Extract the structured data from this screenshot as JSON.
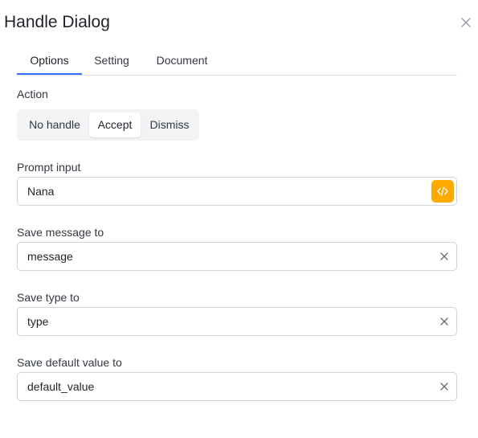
{
  "dialog": {
    "title": "Handle Dialog"
  },
  "tabs": [
    {
      "label": "Options",
      "active": true
    },
    {
      "label": "Setting",
      "active": false
    },
    {
      "label": "Document",
      "active": false
    }
  ],
  "action": {
    "label": "Action",
    "options": [
      "No handle",
      "Accept",
      "Dismiss"
    ],
    "selected": "Accept"
  },
  "prompt_input": {
    "label": "Prompt input",
    "value": "Nana"
  },
  "save_message": {
    "label": "Save message to",
    "value": "message"
  },
  "save_type": {
    "label": "Save type to",
    "value": "type"
  },
  "save_default": {
    "label": "Save default value to",
    "value": "default_value"
  },
  "icons": {
    "close": "close-icon",
    "code": "code-icon",
    "clear": "clear-icon"
  },
  "colors": {
    "accent": "#3370ff",
    "code_button": "#ffaa00",
    "segmented_bg": "#f2f3f5"
  }
}
